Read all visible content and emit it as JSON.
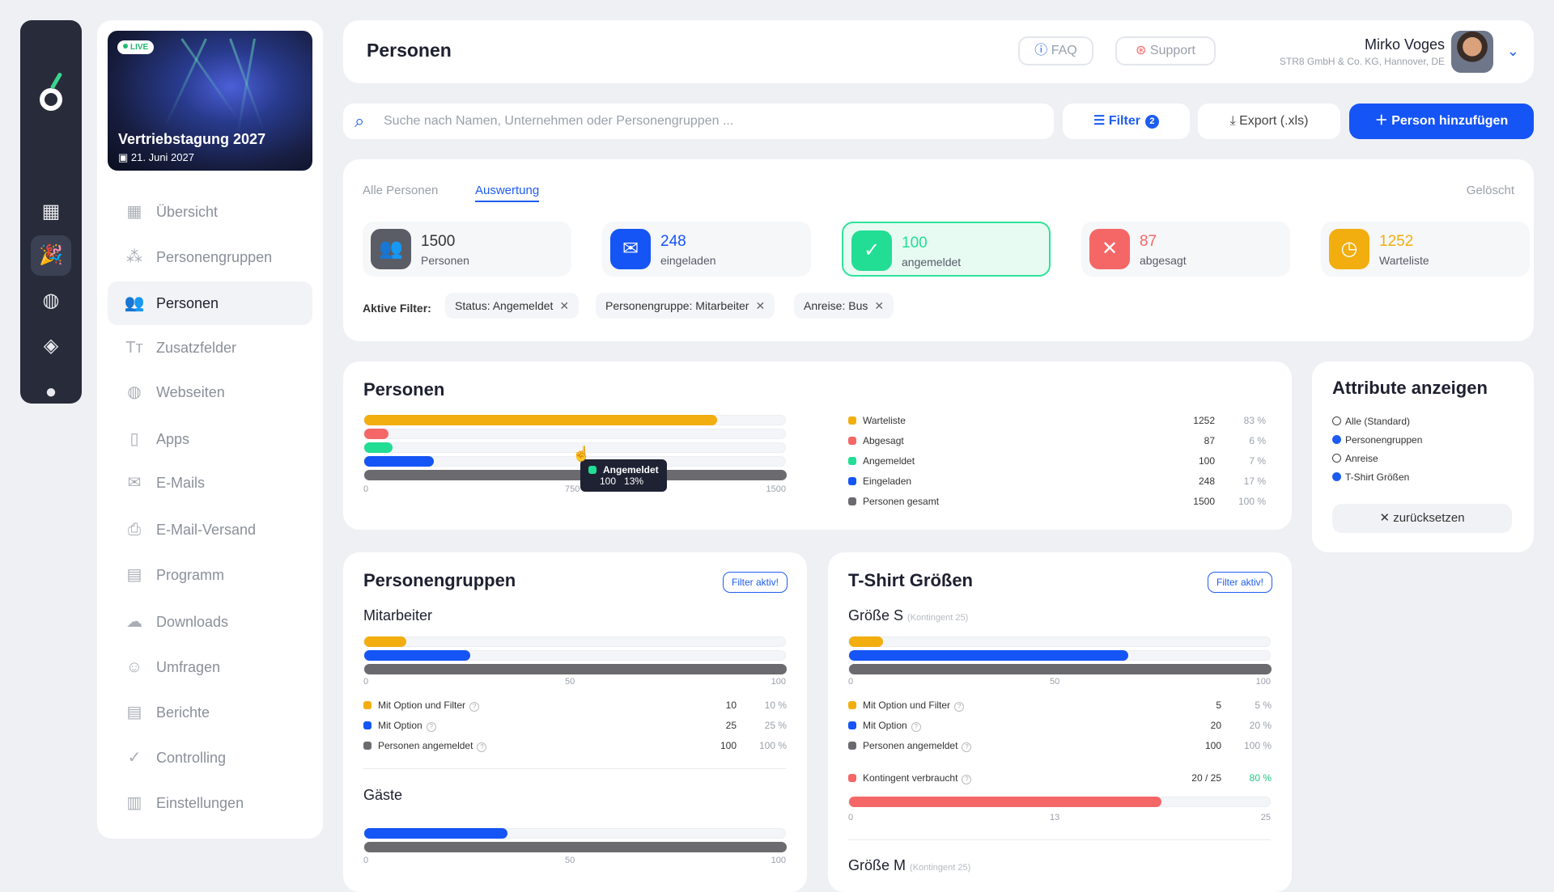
{
  "rail": {
    "icons": [
      "logo-icon",
      "dashboard-icon",
      "party-icon",
      "globe-icon",
      "handshake-icon",
      "user-icon"
    ]
  },
  "event": {
    "live": "LIVE",
    "title": "Vertriebstagung 2027",
    "date": "21. Juni 2027"
  },
  "nav": [
    {
      "label": "Übersicht",
      "icon": "▦"
    },
    {
      "label": "Personengruppen",
      "icon": "⁂"
    },
    {
      "label": "Personen",
      "icon": "👥"
    },
    {
      "label": "Zusatzfelder",
      "icon": "Tт"
    },
    {
      "label": "Webseiten",
      "icon": "◍"
    },
    {
      "label": "Apps",
      "icon": "▯"
    },
    {
      "label": "E-Mails",
      "icon": "✉"
    },
    {
      "label": "E-Mail-Versand",
      "icon": "⎙"
    },
    {
      "label": "Programm",
      "icon": "▤"
    },
    {
      "label": "Downloads",
      "icon": "☁"
    },
    {
      "label": "Umfragen",
      "icon": "☺"
    },
    {
      "label": "Berichte",
      "icon": "▤"
    },
    {
      "label": "Controlling",
      "icon": "✓"
    },
    {
      "label": "Einstellungen",
      "icon": "▥"
    }
  ],
  "header": {
    "title": "Personen",
    "faq": "FAQ",
    "support": "Support",
    "user_name": "Mirko Voges",
    "user_company": "STR8 GmbH & Co. KG, Hannover, DE"
  },
  "toolbar": {
    "search_placeholder": "Suche nach Namen, Unternehmen oder Personengruppen ...",
    "filter": "Filter",
    "filter_count": "2",
    "export": "Export (.xls)",
    "add": "Person hinzufügen"
  },
  "tabs": {
    "all": "Alle Personen",
    "eval": "Auswertung",
    "deleted": "Gelöscht"
  },
  "stats": [
    {
      "value": "1500",
      "label": "Personen",
      "color": "#5a5d66",
      "icon": "👥"
    },
    {
      "value": "248",
      "label": "eingeladen",
      "color": "#1554f5",
      "icon": "✉"
    },
    {
      "value": "100",
      "label": "angemeldet",
      "color": "#22dd94",
      "icon": "✓"
    },
    {
      "value": "87",
      "label": "abgesagt",
      "color": "#f56767",
      "icon": "✕"
    },
    {
      "value": "1252",
      "label": "Warteliste",
      "color": "#f2ae0f",
      "icon": "◷"
    }
  ],
  "filters": {
    "label": "Aktive Filter:",
    "chips": [
      "Status: Angemeldet",
      "Personengruppe: Mitarbeiter",
      "Anreise: Bus"
    ]
  },
  "colors": {
    "warte": "#f2ae0f",
    "abgesagt": "#f56767",
    "angemeldet": "#22dd94",
    "eingeladen": "#1554f5",
    "gesamt": "#6b6b6f",
    "kontingent": "#f56767"
  },
  "personen": {
    "title": "Personen",
    "max": 1500,
    "ticks": [
      "0",
      "750",
      "1500"
    ],
    "rows": [
      {
        "name": "Warteliste",
        "value": 1252,
        "pct": "83 %",
        "color": "#f2ae0f"
      },
      {
        "name": "Abgesagt",
        "value": 87,
        "pct": "6 %",
        "color": "#f56767"
      },
      {
        "name": "Angemeldet",
        "value": 100,
        "pct": "7 %",
        "color": "#22dd94"
      },
      {
        "name": "Eingeladen",
        "value": 248,
        "pct": "17 %",
        "color": "#1554f5"
      },
      {
        "name": "Personen gesamt",
        "value": 1500,
        "pct": "100 %",
        "color": "#6b6b6f"
      }
    ],
    "tooltip": {
      "label": "Angemeldet",
      "value": "100",
      "pct": "13%"
    }
  },
  "gruppen": {
    "title": "Personengruppen",
    "filter_active": "Filter aktiv!",
    "groups": [
      {
        "name": "Mitarbeiter",
        "max": 100,
        "ticks": [
          "0",
          "50",
          "100"
        ],
        "rows": [
          {
            "name": "Mit Option und Filter",
            "value": 10,
            "pct": "10 %",
            "color": "#f2ae0f"
          },
          {
            "name": "Mit Option",
            "value": 25,
            "pct": "25 %",
            "color": "#1554f5"
          },
          {
            "name": "Personen angemeldet",
            "value": 100,
            "pct": "100 %",
            "color": "#6b6b6f"
          }
        ]
      },
      {
        "name": "Gäste",
        "max": 100,
        "ticks": [
          "0",
          "50",
          "100"
        ],
        "bars": [
          {
            "value": 34,
            "color": "#1554f5"
          },
          {
            "value": 100,
            "color": "#6b6b6f"
          }
        ]
      }
    ]
  },
  "tshirt": {
    "title": "T-Shirt Größen",
    "filter_active": "Filter aktiv!",
    "size_s": {
      "name": "Größe S",
      "quota": "(Kontingent 25)",
      "ticks": [
        "0",
        "50",
        "100"
      ],
      "rows": [
        {
          "name": "Mit Option und Filter",
          "value": 5,
          "pct": "5 %",
          "color": "#f2ae0f"
        },
        {
          "name": "Mit Option",
          "value": 20,
          "pct": "20 %",
          "color": "#1554f5"
        },
        {
          "name": "Personen angemeldet",
          "value": 100,
          "pct": "100 %",
          "color": "#6b6b6f"
        }
      ],
      "kontingent": {
        "name": "Kontingent verbraucht",
        "value": "20 / 25",
        "pct": "80 %",
        "fraction": 0.74,
        "ticks": [
          "0",
          "13",
          "25"
        ]
      }
    },
    "size_m": {
      "name": "Größe M",
      "quota": "(Kontingent 25)"
    }
  },
  "attribute": {
    "title": "Attribute anzeigen",
    "options": [
      {
        "label": "Alle (Standard)",
        "checked": false
      },
      {
        "label": "Personengruppen",
        "checked": true
      },
      {
        "label": "Anreise",
        "checked": false
      },
      {
        "label": "T-Shirt Größen",
        "checked": true
      }
    ],
    "reset": "zurücksetzen"
  }
}
